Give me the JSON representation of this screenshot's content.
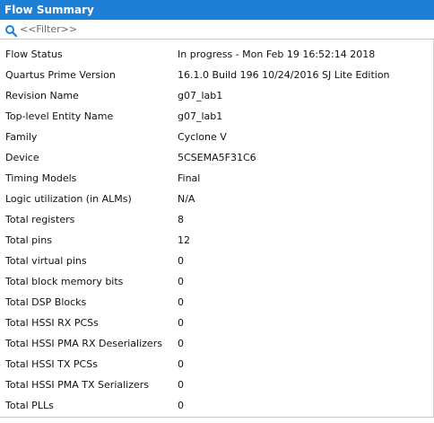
{
  "panel": {
    "title": "Flow Summary"
  },
  "filter": {
    "placeholder": "<<Filter>>"
  },
  "rows": [
    {
      "key": "Flow Status",
      "value": "In progress - Mon Feb 19 16:52:14 2018"
    },
    {
      "key": "Quartus Prime Version",
      "value": "16.1.0 Build 196 10/24/2016 SJ Lite Edition"
    },
    {
      "key": "Revision Name",
      "value": "g07_lab1"
    },
    {
      "key": "Top-level Entity Name",
      "value": "g07_lab1"
    },
    {
      "key": "Family",
      "value": "Cyclone V"
    },
    {
      "key": "Device",
      "value": "5CSEMA5F31C6"
    },
    {
      "key": "Timing Models",
      "value": "Final"
    },
    {
      "key": "Logic utilization (in ALMs)",
      "value": "N/A"
    },
    {
      "key": "Total registers",
      "value": "8"
    },
    {
      "key": "Total pins",
      "value": "12"
    },
    {
      "key": "Total virtual pins",
      "value": "0"
    },
    {
      "key": "Total block memory bits",
      "value": "0"
    },
    {
      "key": "Total DSP Blocks",
      "value": "0"
    },
    {
      "key": "Total HSSI RX PCSs",
      "value": "0"
    },
    {
      "key": "Total HSSI PMA RX Deserializers",
      "value": "0"
    },
    {
      "key": "Total HSSI TX PCSs",
      "value": "0"
    },
    {
      "key": "Total HSSI PMA TX Serializers",
      "value": "0"
    },
    {
      "key": "Total PLLs",
      "value": "0"
    }
  ],
  "colors": {
    "titlebar": "#1d7fd6",
    "search_icon": "#1d7fd6"
  },
  "icons": {
    "filter": "search-icon"
  }
}
